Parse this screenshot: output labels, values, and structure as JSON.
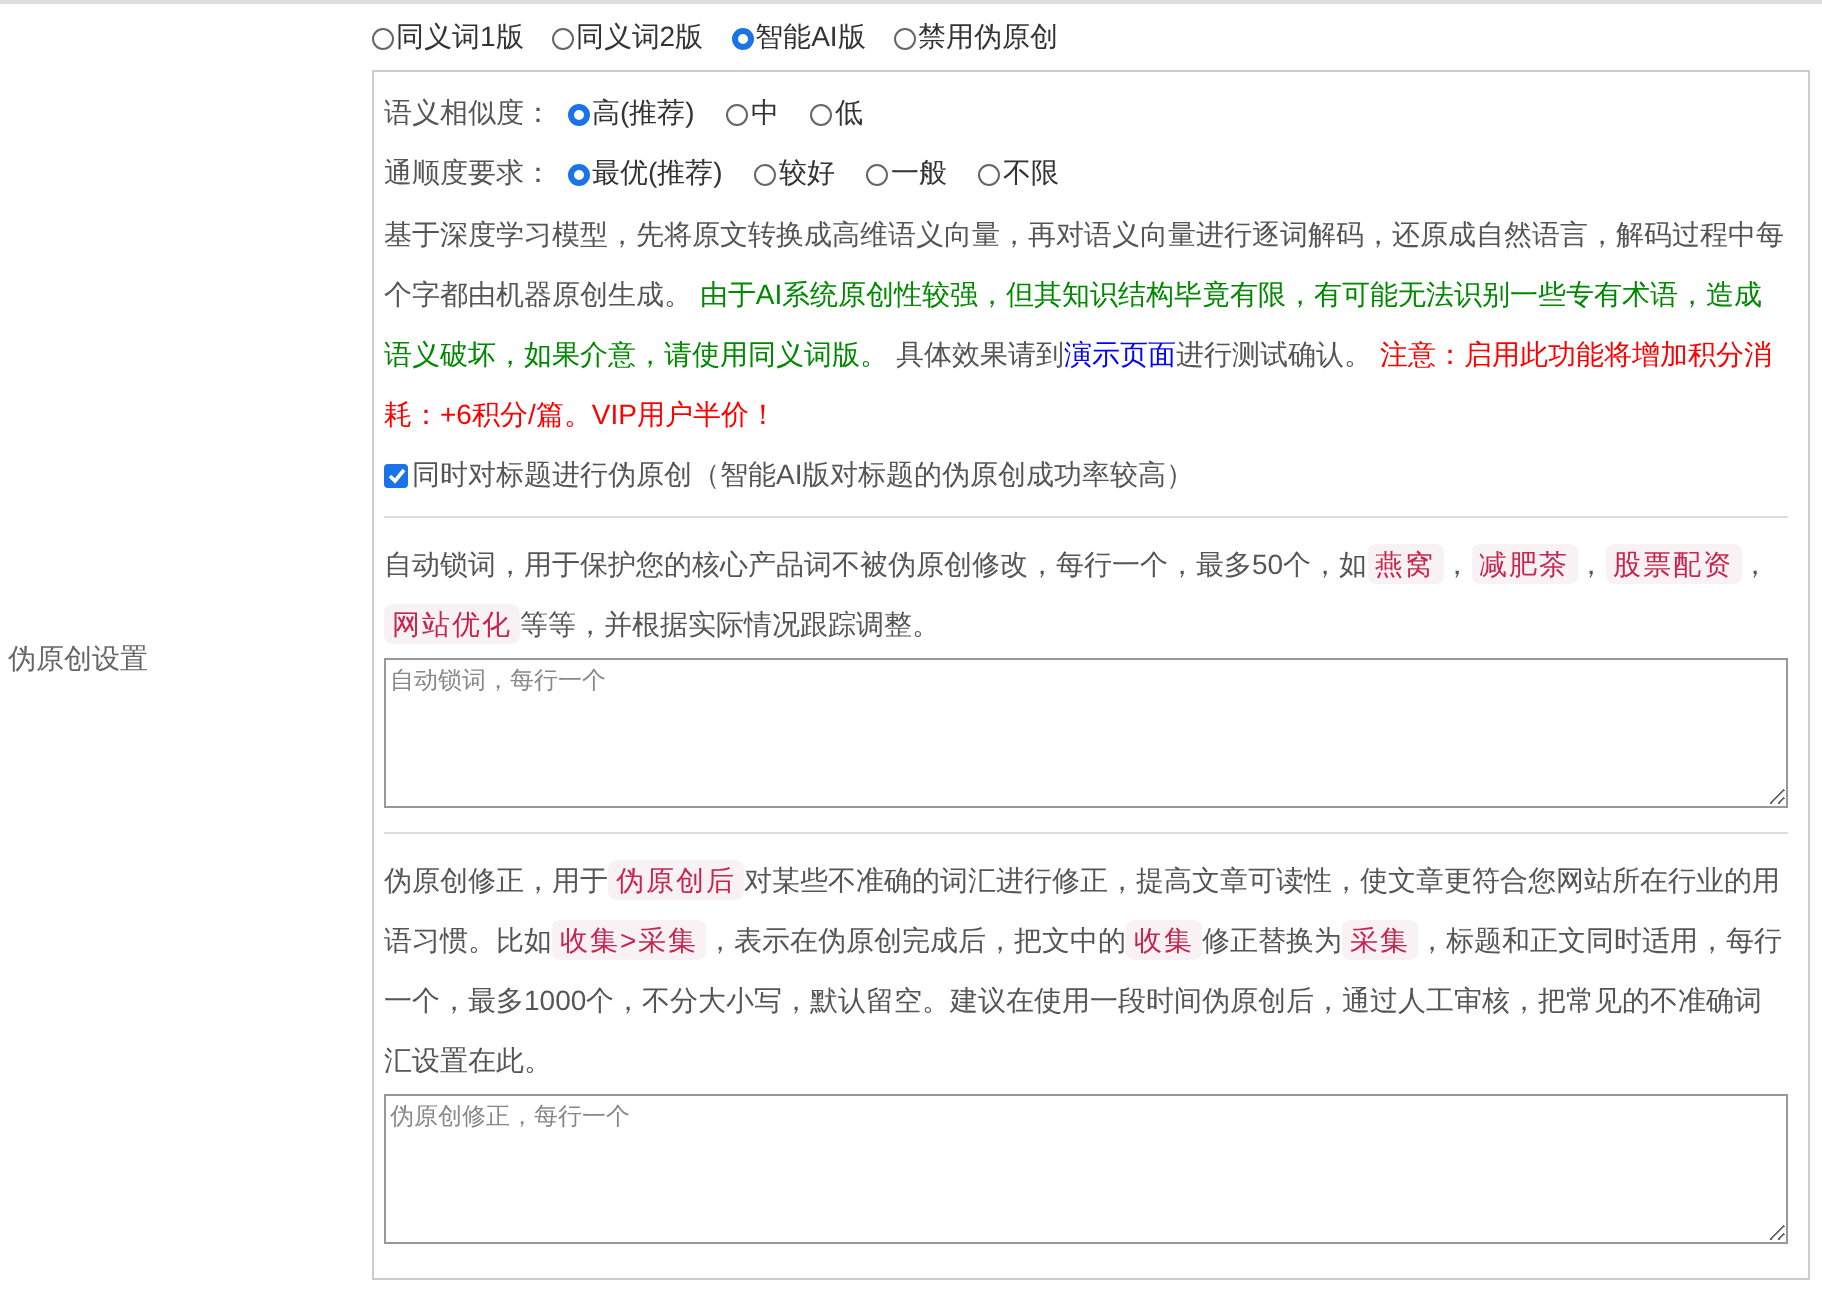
{
  "section_label": "伪原创设置",
  "modes": [
    {
      "label": "同义词1版",
      "selected": false
    },
    {
      "label": "同义词2版",
      "selected": false
    },
    {
      "label": "智能AI版",
      "selected": true
    },
    {
      "label": "禁用伪原创",
      "selected": false
    }
  ],
  "settings": [
    {
      "label": "语义相似度：",
      "options": [
        {
          "label": "高(推荐)",
          "selected": true
        },
        {
          "label": "中",
          "selected": false
        },
        {
          "label": "低",
          "selected": false
        }
      ]
    },
    {
      "label": "通顺度要求：",
      "options": [
        {
          "label": "最优(推荐)",
          "selected": true
        },
        {
          "label": "较好",
          "selected": false
        },
        {
          "label": "一般",
          "selected": false
        },
        {
          "label": "不限",
          "selected": false
        }
      ]
    }
  ],
  "description": [
    {
      "kind": "plain",
      "text": "基于深度学习模型，先将原文转换成高维语义向量，再对语义向量进行逐词解码，还原成自然语言，解码过程中每个字都由机器原创生成。 "
    },
    {
      "kind": "green",
      "text": "由于AI系统原创性较强，但其知识结构毕竟有限，有可能无法识别一些专有术语，造成语义破坏，如果介意，请使用同义词版。"
    },
    {
      "kind": "plain",
      "text": " 具体效果请到"
    },
    {
      "kind": "link",
      "text": "演示页面"
    },
    {
      "kind": "plain",
      "text": "进行测试确认。 "
    },
    {
      "kind": "red",
      "text": "注意：启用此功能将增加积分消耗：+6积分/篇。VIP用户半价！"
    }
  ],
  "title_option": {
    "label": "同时对标题进行伪原创（智能AI版对标题的伪原创成功率较高）",
    "checked": true
  },
  "lock_words": {
    "description": [
      {
        "kind": "plain",
        "text": "自动锁词，用于保护您的核心产品词不被伪原创修改，每行一个，最多50个，如"
      },
      {
        "kind": "code",
        "text": "燕窝"
      },
      {
        "kind": "plain",
        "text": "，"
      },
      {
        "kind": "code",
        "text": "减肥茶"
      },
      {
        "kind": "plain",
        "text": "，"
      },
      {
        "kind": "code",
        "text": "股票配资"
      },
      {
        "kind": "plain",
        "text": "，"
      },
      {
        "kind": "code",
        "text": "网站优化"
      },
      {
        "kind": "plain",
        "text": "等等，并根据实际情况跟踪调整。"
      }
    ],
    "placeholder": "自动锁词，每行一个"
  },
  "corrections": {
    "description": [
      {
        "kind": "plain",
        "text": "伪原创修正，用于"
      },
      {
        "kind": "code",
        "text": "伪原创后"
      },
      {
        "kind": "plain",
        "text": "对某些不准确的词汇进行修正，提高文章可读性，使文章更符合您网站所在行业的用语习惯。比如"
      },
      {
        "kind": "code",
        "text": "收集>采集"
      },
      {
        "kind": "plain",
        "text": "，表示在伪原创完成后，把文中的"
      },
      {
        "kind": "code",
        "text": "收集"
      },
      {
        "kind": "plain",
        "text": "修正替换为"
      },
      {
        "kind": "code",
        "text": "采集"
      },
      {
        "kind": "plain",
        "text": "，标题和正文同时适用，每行一个，最多1000个，不分大小写，默认留空。建议在使用一段时间伪原创后，通过人工审核，把常见的不准确词汇设置在此。"
      }
    ],
    "placeholder": "伪原创修正，每行一个"
  }
}
